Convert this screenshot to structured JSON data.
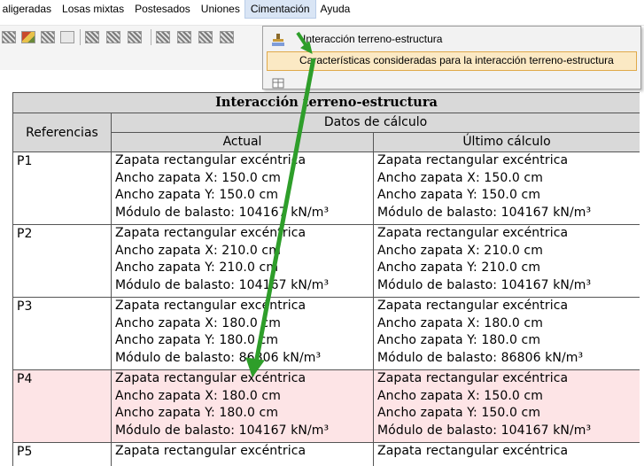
{
  "menubar": {
    "items": [
      "; aligeradas",
      "Losas mixtas",
      "Postesados",
      "Uniones",
      "Cimentación",
      "Ayuda"
    ]
  },
  "dropdown": {
    "items": [
      {
        "label": "Interacción terreno-estructura",
        "icon": "soil-structure-icon"
      },
      {
        "label": "Características consideradas para la interacción terreno-estructura",
        "icon": "none"
      }
    ]
  },
  "colors": {
    "annotation_arrow": "#2e9e2a",
    "header_bg": "#d9d9d9",
    "highlight_row": "#fde4e6",
    "menu_highlight": "#fbe9c4"
  },
  "table": {
    "title": "Interacción terreno-estructura",
    "col_references": "Referencias",
    "group_header": "Datos de cálculo",
    "col_actual": "Actual",
    "col_last": "Último cálculo",
    "rows": [
      {
        "ref": "P1",
        "actual": [
          "Zapata rectangular excéntrica",
          "Ancho zapata X: 150.0 cm",
          "Ancho zapata Y: 150.0 cm",
          "Módulo de balasto: 104167 kN/m³"
        ],
        "last": [
          "Zapata rectangular excéntrica",
          "Ancho zapata X: 150.0 cm",
          "Ancho zapata Y: 150.0 cm",
          "Módulo de balasto: 104167 kN/m³"
        ]
      },
      {
        "ref": "P2",
        "actual": [
          "Zapata rectangular excéntrica",
          "Ancho zapata X: 210.0 cm",
          "Ancho zapata Y: 210.0 cm",
          "Módulo de balasto: 104167 kN/m³"
        ],
        "last": [
          "Zapata rectangular excéntrica",
          "Ancho zapata X: 210.0 cm",
          "Ancho zapata Y: 210.0 cm",
          "Módulo de balasto: 104167 kN/m³"
        ]
      },
      {
        "ref": "P3",
        "actual": [
          "Zapata rectangular excéntrica",
          "Ancho zapata X: 180.0 cm",
          "Ancho zapata Y: 180.0 cm",
          "Módulo de balasto: 86806 kN/m³"
        ],
        "last": [
          "Zapata rectangular excéntrica",
          "Ancho zapata X: 180.0 cm",
          "Ancho zapata Y: 180.0 cm",
          "Módulo de balasto: 86806 kN/m³"
        ]
      },
      {
        "ref": "P4",
        "actual": [
          "Zapata rectangular excéntrica",
          "Ancho zapata X: 180.0 cm",
          "Ancho zapata Y: 180.0 cm",
          "Módulo de balasto: 104167 kN/m³"
        ],
        "last": [
          "Zapata rectangular excéntrica",
          "Ancho zapata X: 150.0 cm",
          "Ancho zapata Y: 150.0 cm",
          "Módulo de balasto: 104167 kN/m³"
        ]
      },
      {
        "ref": "P5",
        "actual": [
          "Zapata rectangular excéntrica"
        ],
        "last": [
          "Zapata rectangular excéntrica"
        ]
      }
    ]
  }
}
